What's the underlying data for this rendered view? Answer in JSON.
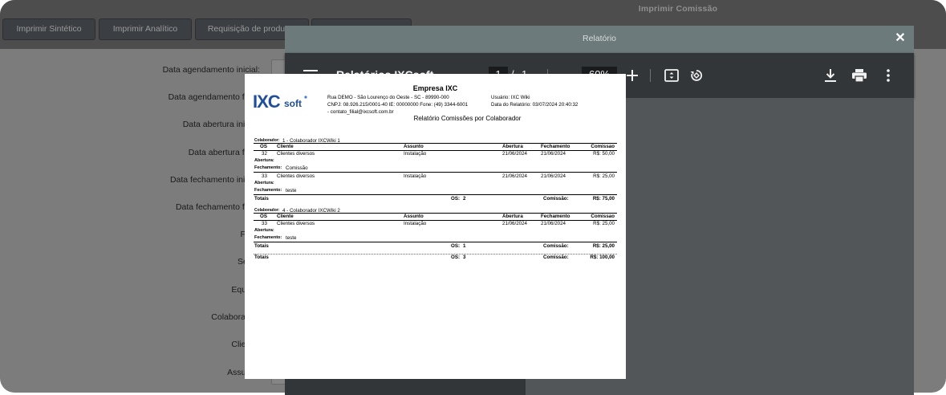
{
  "app": {
    "title": "Imprimir Comissão"
  },
  "tabs": [
    "Imprimir Sintético",
    "Imprimir Analítico",
    "Requisição de produtos",
    ""
  ],
  "form": {
    "fields": [
      "Data agendamento inicial:",
      "Data agendamento final:",
      "Data abertura inicial:",
      "Data abertura final:",
      "Data fechamento inicial:",
      "Data fechamento final:",
      "Filial:",
      "Setor:",
      "Equipe:",
      "Colaborador:",
      "Cliente:",
      "Assunto:"
    ]
  },
  "modal": {
    "title": "Relatório",
    "close": "✕"
  },
  "pdf": {
    "doc_name": "Relatórios IXCsoft",
    "page_current": "1",
    "page_sep": "/",
    "page_total": "1",
    "zoom": "60%",
    "thumb_label": "1"
  },
  "report": {
    "logo_a": "IXC",
    "logo_b": "soft",
    "company": "Empresa IXC",
    "address": "Rua DEMO - São Lourenço do Oeste - SC - 89990-000",
    "cnpj": "CNPJ: 08.926.215/0001-40  IE: 00000000  Fone: (49) 3344-6001",
    "email": " - contato_filial@ixcsoft.com.br",
    "user": "Usuário: IXC Wiki",
    "report_date": "Data do Relatório: 03/07/2024 20:40:32",
    "title": "Relatório Comissões por Colaborador",
    "headers": [
      "OS",
      "Cliente",
      "Assunto",
      "Abertura",
      "Fechamento",
      "Comissao"
    ],
    "collab_label": "Colaborador:",
    "groups": [
      {
        "collaborator": "1 - Colaborador IXCWiki 1",
        "rows": [
          {
            "os": "32",
            "cliente": "Clientes diversos",
            "assunto": "Instalação",
            "abertura": "21/06/2024",
            "fechamento": "21/06/2024",
            "comissao": "R$: 50,00",
            "abertura_obs": "",
            "fechamento_obs": "Comissão"
          },
          {
            "os": "33",
            "cliente": "Clientes diversos",
            "assunto": "Instalação",
            "abertura": "21/06/2024",
            "fechamento": "21/06/2024",
            "comissao": "R$: 25,00",
            "abertura_obs": "",
            "fechamento_obs": "teste"
          }
        ],
        "total_label": "Totais",
        "os_label": "OS:",
        "os_count": "2",
        "com_label": "Comissão:",
        "com_total": "R$: 75,00"
      },
      {
        "collaborator": "4 - Colaborador IXCWiki 2",
        "rows": [
          {
            "os": "33",
            "cliente": "Clientes diversos",
            "assunto": "Instalação",
            "abertura": "21/06/2024",
            "fechamento": "21/06/2024",
            "comissao": "R$: 25,00",
            "abertura_obs": "",
            "fechamento_obs": "teste"
          }
        ],
        "total_label": "Totais",
        "os_label": "OS:",
        "os_count": "1",
        "com_label": "Comissão:",
        "com_total": "R$: 25,00"
      }
    ],
    "abertura_label": "Abertura:",
    "fechamento_label": "Fechamento:",
    "grand": {
      "label": "Totais",
      "os_label": "OS:",
      "os_count": "3",
      "com_label": "Comissão:",
      "com_total": "R$: 100,00"
    }
  },
  "colors": {
    "accent": "#8ab4f8",
    "toolbar": "#323639",
    "viewer": "#525659",
    "modal_header": "#6c7a7b"
  }
}
